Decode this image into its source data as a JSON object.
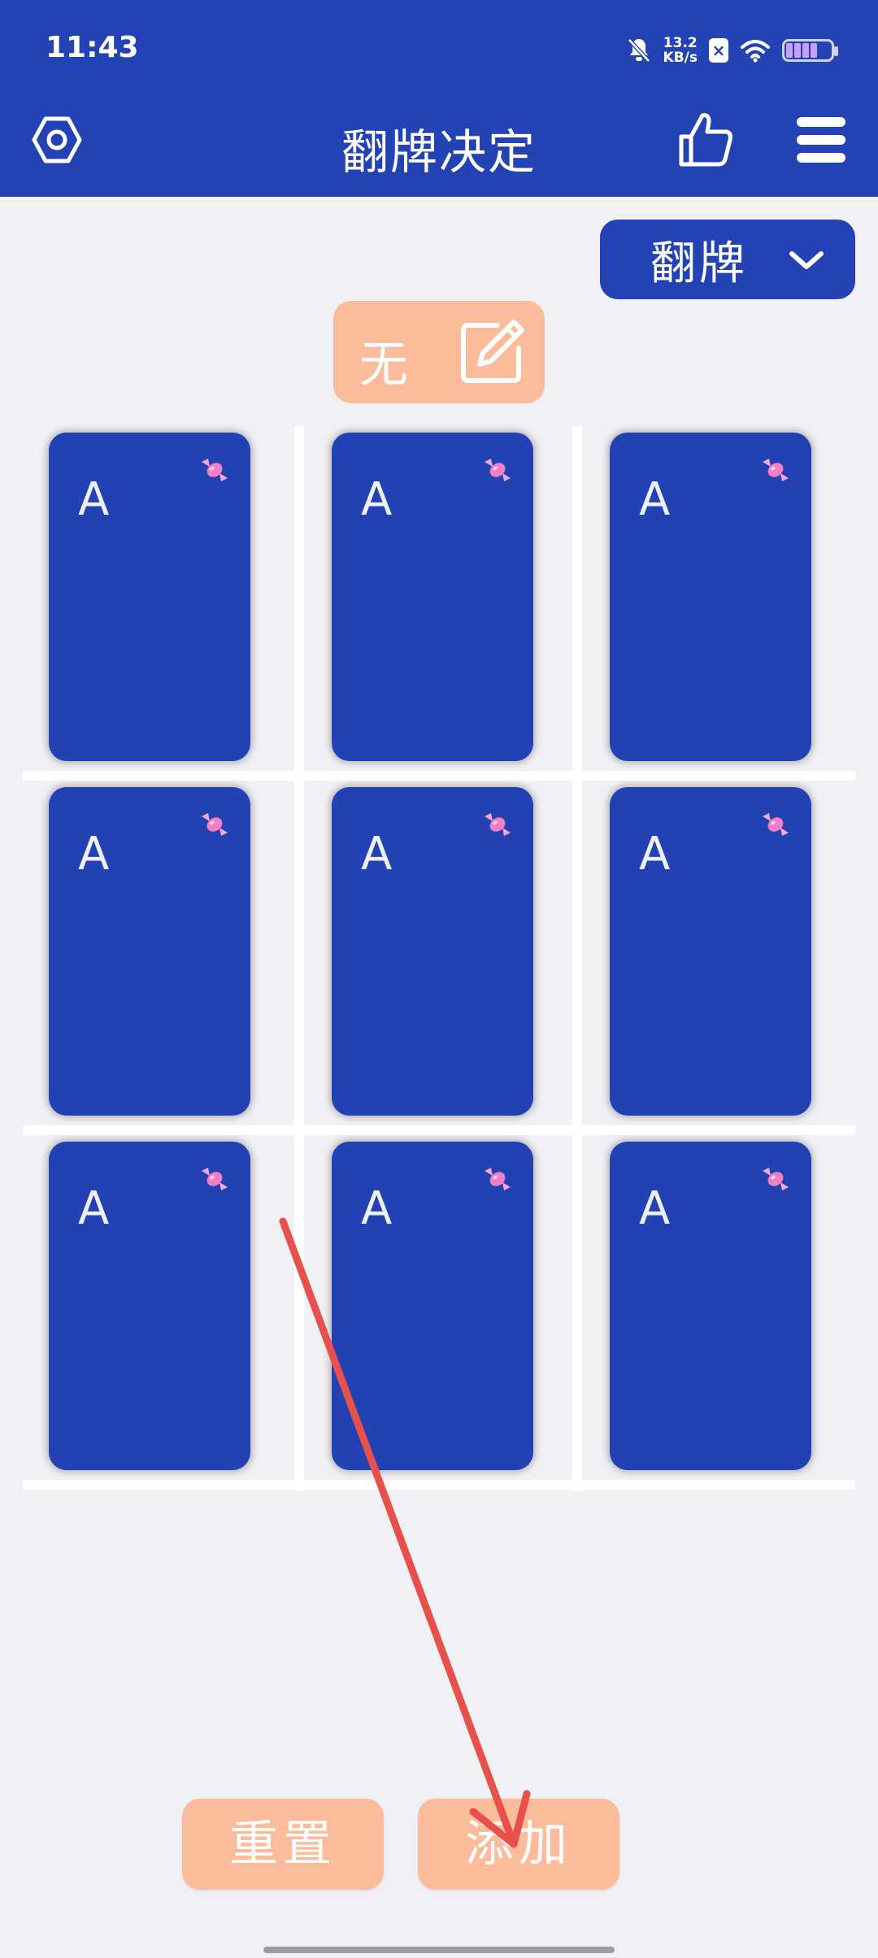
{
  "status_bar": {
    "time": "11:43",
    "net_speed_value": "13.2",
    "net_speed_unit": "KB/s"
  },
  "app_bar": {
    "title": "翻牌决定",
    "icons": [
      "settings-hex-icon",
      "thumbs-up-icon",
      "menu-icon"
    ]
  },
  "mode_dropdown": {
    "selected": "翻牌"
  },
  "title_pill": {
    "text": "无"
  },
  "cards": [
    {
      "letter": "A"
    },
    {
      "letter": "A"
    },
    {
      "letter": "A"
    },
    {
      "letter": "A"
    },
    {
      "letter": "A"
    },
    {
      "letter": "A"
    },
    {
      "letter": "A"
    },
    {
      "letter": "A"
    },
    {
      "letter": "A"
    }
  ],
  "buttons": {
    "reset_label": "重置",
    "add_label": "添加"
  },
  "colors": {
    "primary": "#2342b4",
    "accent_peach": "#fcbc9b",
    "background": "#f1f0f4",
    "annotation_arrow": "#e8504c"
  }
}
